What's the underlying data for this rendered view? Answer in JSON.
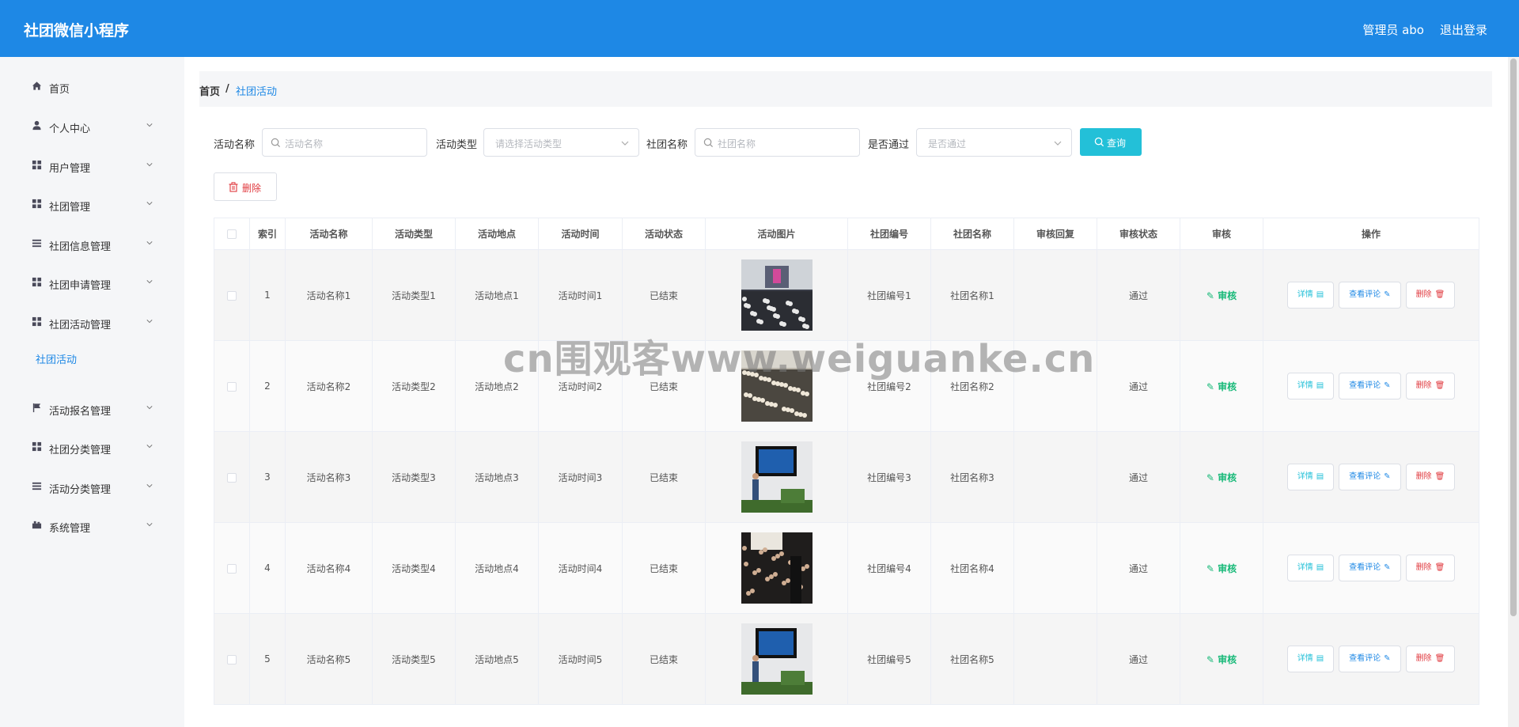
{
  "header": {
    "title": "社团微信小程序",
    "user": "管理员 abo",
    "logout": "退出登录"
  },
  "sidebar": {
    "items": [
      {
        "label": "首页",
        "icon": "home-icon",
        "chevron": false
      },
      {
        "label": "个人中心",
        "icon": "user-icon",
        "chevron": true
      },
      {
        "label": "用户管理",
        "icon": "grid-icon",
        "chevron": true
      },
      {
        "label": "社团管理",
        "icon": "grid-icon",
        "chevron": true
      },
      {
        "label": "社团信息管理",
        "icon": "list-icon",
        "chevron": true
      },
      {
        "label": "社团申请管理",
        "icon": "grid-icon",
        "chevron": true
      },
      {
        "label": "社团活动管理",
        "icon": "grid-icon",
        "chevron": true
      },
      {
        "label": "活动报名管理",
        "icon": "flag-icon",
        "chevron": true
      },
      {
        "label": "社团分类管理",
        "icon": "grid-icon",
        "chevron": true
      },
      {
        "label": "活动分类管理",
        "icon": "list-icon",
        "chevron": true
      },
      {
        "label": "系统管理",
        "icon": "settings-icon",
        "chevron": true
      }
    ],
    "active_sub": "社团活动"
  },
  "breadcrumb": {
    "home": "首页",
    "sep": "/",
    "current": "社团活动"
  },
  "filters": {
    "name_label": "活动名称",
    "name_placeholder": "活动名称",
    "type_label": "活动类型",
    "type_placeholder": "请选择活动类型",
    "club_label": "社团名称",
    "club_placeholder": "社团名称",
    "pass_label": "是否通过",
    "pass_placeholder": "是否通过",
    "query": "查询"
  },
  "actions": {
    "delete": "删除"
  },
  "table": {
    "columns": [
      "索引",
      "活动名称",
      "活动类型",
      "活动地点",
      "活动时间",
      "活动状态",
      "活动图片",
      "社团编号",
      "社团名称",
      "审核回复",
      "审核状态",
      "审核",
      "操作"
    ],
    "rows": [
      {
        "index": "1",
        "name": "活动名称1",
        "type": "活动类型1",
        "place": "活动地点1",
        "time": "活动时间1",
        "status": "已结束",
        "club_no": "社团编号1",
        "club_name": "社团名称1",
        "reply": "",
        "audit_status": "通过"
      },
      {
        "index": "2",
        "name": "活动名称2",
        "type": "活动类型2",
        "place": "活动地点2",
        "time": "活动时间2",
        "status": "已结束",
        "club_no": "社团编号2",
        "club_name": "社团名称2",
        "reply": "",
        "audit_status": "通过"
      },
      {
        "index": "3",
        "name": "活动名称3",
        "type": "活动类型3",
        "place": "活动地点3",
        "time": "活动时间3",
        "status": "已结束",
        "club_no": "社团编号3",
        "club_name": "社团名称3",
        "reply": "",
        "audit_status": "通过"
      },
      {
        "index": "4",
        "name": "活动名称4",
        "type": "活动类型4",
        "place": "活动地点4",
        "time": "活动时间4",
        "status": "已结束",
        "club_no": "社团编号4",
        "club_name": "社团名称4",
        "reply": "",
        "audit_status": "通过"
      },
      {
        "index": "5",
        "name": "活动名称5",
        "type": "活动类型5",
        "place": "活动地点5",
        "time": "活动时间5",
        "status": "已结束",
        "club_no": "社团编号5",
        "club_name": "社团名称5",
        "reply": "",
        "audit_status": "通过"
      }
    ],
    "audit_label": "审核",
    "op_detail": "详情",
    "op_comment": "查看评论",
    "op_delete": "删除"
  },
  "watermark": "cn围观客www.weiguanke.cn",
  "colors": {
    "primary": "#1e88e5",
    "query": "#23c0d8",
    "danger": "#e0393e",
    "audit": "#17b978"
  }
}
